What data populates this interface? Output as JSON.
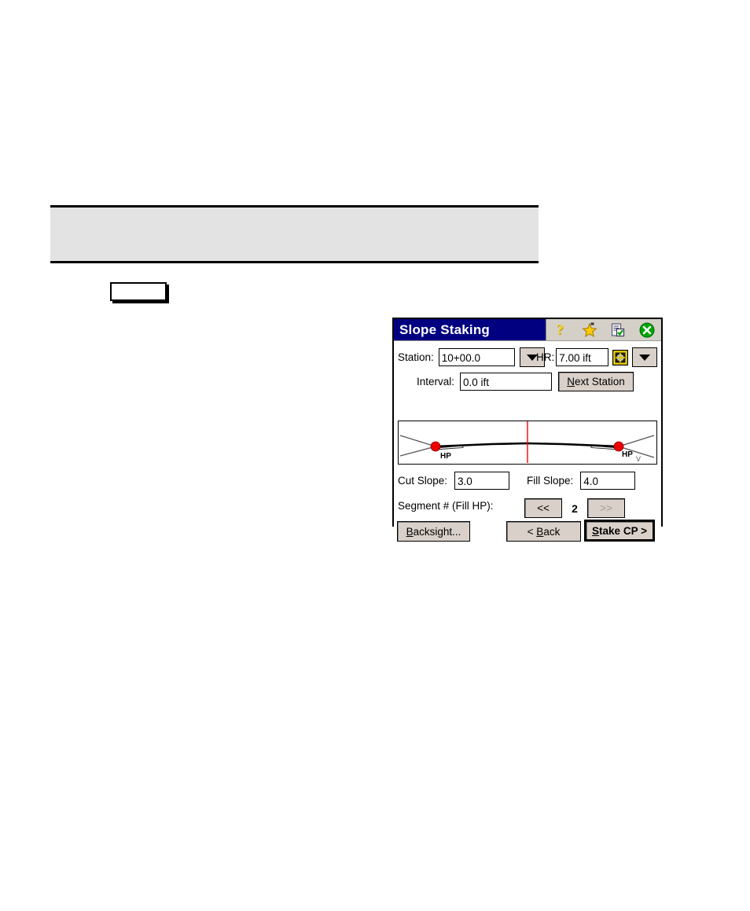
{
  "page": {
    "banner": {
      "text": ""
    },
    "empty_box": {
      "text": ""
    }
  },
  "dialog": {
    "title": "Slope Staking",
    "titlebar_icons": [
      {
        "name": "help-icon",
        "glyph": "?"
      },
      {
        "name": "favorites-star-icon",
        "glyph": "*"
      },
      {
        "name": "checklist-document-icon",
        "glyph": ""
      },
      {
        "name": "close-icon",
        "glyph": "X"
      }
    ],
    "colors": {
      "titlebar": "#000080",
      "titlebar_text": "#ffffff",
      "button_face": "#d9d0c9",
      "icon_tray": "#d4d0c8",
      "close_green": "#00a000",
      "star_yellow": "#ffd700",
      "centerline_red": "#ff0000",
      "hinge_point_red": "#ee0000",
      "banner_gray": "#e3e3e3"
    },
    "station": {
      "label": "Station:",
      "value": "10+00.0",
      "placeholder": "",
      "dropdown": "chevron-down-icon"
    },
    "hr": {
      "label": "HR:",
      "value": "7.00 ift",
      "placeholder": "",
      "target_icon": "target-prism-icon",
      "dropdown": "chevron-down-icon"
    },
    "interval": {
      "label": "Interval:",
      "value": "0.0 ift",
      "placeholder": ""
    },
    "next_station_button": "Next Station",
    "cut_slope": {
      "label": "Cut Slope:",
      "value": "3.0",
      "placeholder": ""
    },
    "fill_slope": {
      "label": "Fill Slope:",
      "value": "4.0",
      "placeholder": ""
    },
    "segment": {
      "label": "Segment # (Fill HP):",
      "prev_button": "<<",
      "value": "2",
      "next_button": ">>",
      "next_enabled": false
    },
    "footer": {
      "backsight_button": "Backsight...",
      "back_button": "< Back",
      "stake_button": "Stake CP >"
    },
    "cross_section": {
      "left_hinge_label": "HP",
      "right_hinge_label": "HP",
      "right_vertical_label": "V"
    }
  }
}
